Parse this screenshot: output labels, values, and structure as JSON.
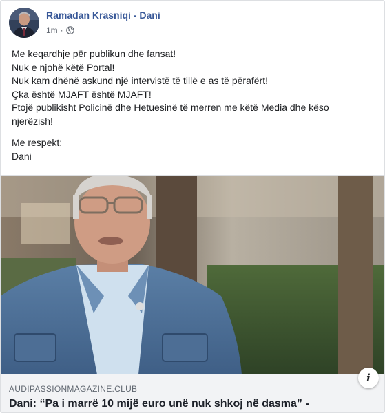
{
  "post": {
    "author": "Ramadan Krasniqi - Dani",
    "timestamp": "1m",
    "separator": "·",
    "privacy_icon": "globe-icon",
    "lines": [
      "Me keqardhje për publikun dhe fansat!",
      "Nuk e njohë këtë Portal!",
      "Nuk kam dhënë askund një intervistë të tillë e as të përafërt!",
      "Çka është MJAFT është MJAFT!",
      "Ftojë publikisht Policinë dhe Hetuesinë të merren me këtë Media dhe këso",
      "njerëzish!"
    ],
    "closing": "Me respekt;",
    "signature": "Dani"
  },
  "link_preview": {
    "domain": "AUDIPASSIONMAGAZINE.CLUB",
    "title": "Dani: “Pa i marrë 10 mijë euro unë nuk shkoj në dasma” -",
    "info_label": "i"
  },
  "colors": {
    "author_link": "#385898",
    "meta_text": "#616770",
    "preview_bg": "#f2f3f5",
    "border": "#dddfe2"
  }
}
